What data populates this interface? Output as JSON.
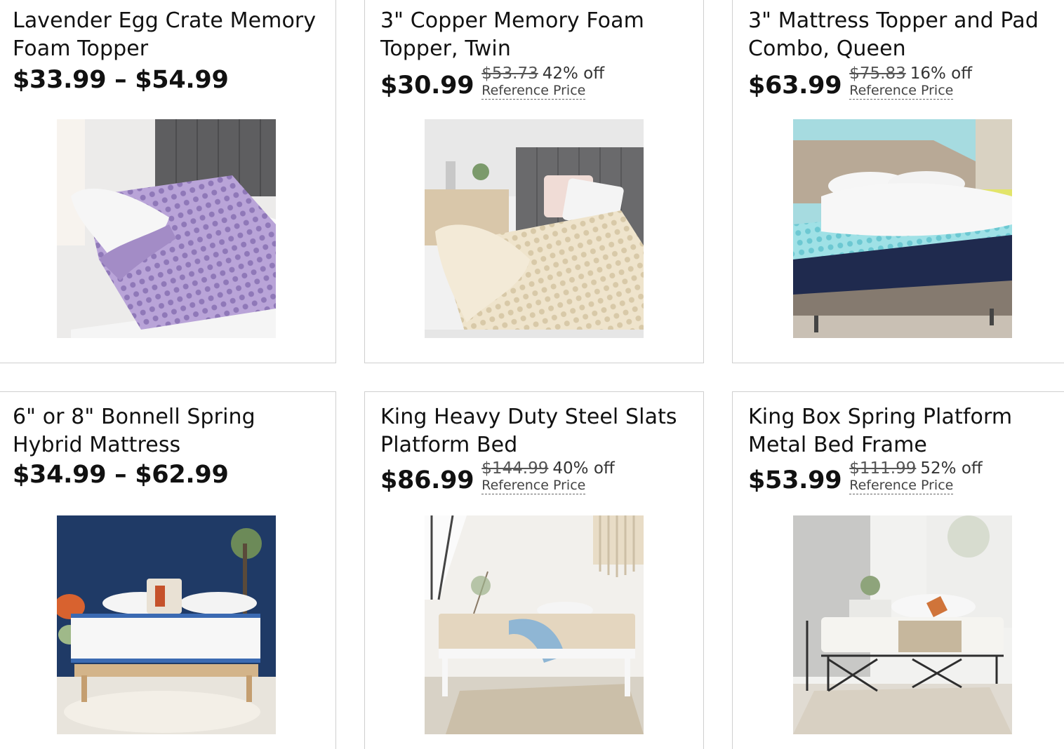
{
  "products": [
    {
      "title": "Lavender Egg Crate Memory Foam Topper",
      "price_range": "$33.99 – $54.99",
      "image": "lavender-egg-crate-topper-image"
    },
    {
      "title": "3\" Copper Memory Foam Topper, Twin",
      "price": "$30.99",
      "was_price": "$53.73",
      "discount": "42% off",
      "reference_label": "Reference Price",
      "image": "copper-memory-foam-topper-image"
    },
    {
      "title": "3\" Mattress Topper and Pad Combo, Queen",
      "price": "$63.99",
      "was_price": "$75.83",
      "discount": "16% off",
      "reference_label": "Reference Price",
      "image": "mattress-topper-pad-combo-image"
    },
    {
      "title": "6\" or 8\" Bonnell Spring Hybrid Mattress",
      "price_range": "$34.99 – $62.99",
      "image": "bonnell-spring-hybrid-mattress-image"
    },
    {
      "title": "King Heavy Duty Steel Slats Platform Bed",
      "price": "$86.99",
      "was_price": "$144.99",
      "discount": "40% off",
      "reference_label": "Reference Price",
      "image": "steel-slats-platform-bed-image"
    },
    {
      "title": "King Box Spring Platform Metal Bed Frame",
      "price": "$53.99",
      "was_price": "$111.99",
      "discount": "52% off",
      "reference_label": "Reference Price",
      "image": "metal-bed-frame-image"
    }
  ],
  "colors": {
    "text": "#111111",
    "border": "#cfcfcf",
    "muted": "#555555"
  }
}
